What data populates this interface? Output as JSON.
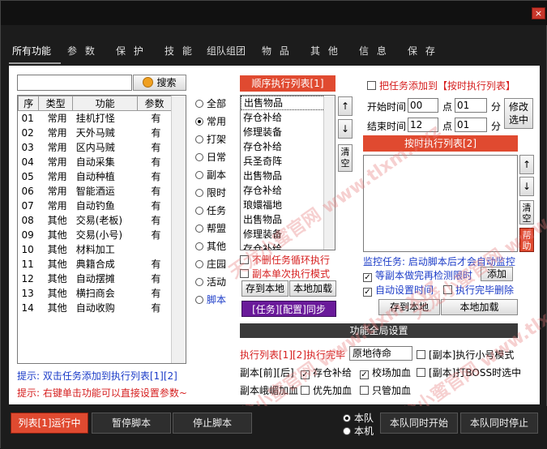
{
  "tabs": [
    "所有功能",
    "参 数",
    "保 护",
    "技 能",
    "组队组团",
    "物 品",
    "其 他",
    "信 息",
    "保 存"
  ],
  "search": {
    "value": "",
    "button": "搜索"
  },
  "table": {
    "headers": [
      "序",
      "类型",
      "功能",
      "参数"
    ],
    "rows": [
      [
        "01",
        "常用",
        "挂机打怪",
        "有"
      ],
      [
        "02",
        "常用",
        "天外马贼",
        "有"
      ],
      [
        "03",
        "常用",
        "区内马贼",
        "有"
      ],
      [
        "04",
        "常用",
        "自动采集",
        "有"
      ],
      [
        "05",
        "常用",
        "自动种植",
        "有"
      ],
      [
        "06",
        "常用",
        "智能酒运",
        "有"
      ],
      [
        "07",
        "常用",
        "自动钓鱼",
        "有"
      ],
      [
        "08",
        "其他",
        "交易(老板)",
        "有"
      ],
      [
        "09",
        "其他",
        "交易(小号)",
        "有"
      ],
      [
        "10",
        "其他",
        "材料加工",
        ""
      ],
      [
        "11",
        "其他",
        "典籍合成",
        "有"
      ],
      [
        "12",
        "其他",
        "自动摆摊",
        "有"
      ],
      [
        "13",
        "其他",
        "横扫商会",
        "有"
      ],
      [
        "14",
        "其他",
        "自动收购",
        "有"
      ]
    ]
  },
  "categories": [
    "全部",
    "常用",
    "打架",
    "日常",
    "副本",
    "限时",
    "任务",
    "帮盟",
    "其他",
    "庄园",
    "活动",
    "脚本"
  ],
  "category_selected": "常用",
  "hints": {
    "hint1": "提示: 双击任务添加到执行列表[1][2]",
    "hint2": "提示: 右键单击功能可以直接设置参数~"
  },
  "seq_list": {
    "title": "顺序执行列表[1]",
    "items": [
      "出售物品",
      "存仓补给",
      "修理装备",
      "存仓补给",
      "兵圣奇阵",
      "出售物品",
      "存仓补给",
      "琅嬛福地",
      "出售物品",
      "修理装备",
      "存仓补给"
    ],
    "up": "↑",
    "down": "↓",
    "clear": "清空"
  },
  "seq_options": {
    "no_delete_loop": "不删任务循环执行",
    "single_dungeon": "副本单次执行模式",
    "save_local": "存到本地",
    "load_local": "本地加载",
    "sync": "[任务][配置]同步"
  },
  "timed": {
    "add_label": "把任务添加到【按时执行列表】",
    "start_label": "开始时间",
    "end_label": "结束时间",
    "start_h": "00",
    "start_m": "01",
    "end_h": "12",
    "end_m": "01",
    "point": "点",
    "minute": "分",
    "modify": "修改选中",
    "list_title": "按时执行列表[2]",
    "up": "↑",
    "down": "↓",
    "clear": "清空",
    "help": "帮助",
    "monitor": "监控任务: 启动脚本后才会自动监控",
    "wait_dungeon": "等副本做完再检测限时",
    "add": "添加",
    "auto_time": "自动设置时间",
    "done_delete": "执行完毕删除",
    "save_local": "存到本地",
    "load_local": "本地加载"
  },
  "global": {
    "title": "功能全局设置",
    "after_exec_label": "执行列表[1][2]执行完毕",
    "after_exec_value": "原地待命",
    "small_mode": "[副本]执行小号模式",
    "dungeon_before_after": "副本[前][后]",
    "store_supply": "存仓补给",
    "arena_buff": "校场加血",
    "boss_fight": "[副本]打BOSS时选中",
    "dungeon_eyebrow": "副本峨嵋加血",
    "priority_buff": "优先加血",
    "only_buff": "只管加血"
  },
  "bottom": {
    "running": "列表[1]运行中",
    "pause": "暂停脚本",
    "stop": "停止脚本",
    "team": "本队",
    "machine": "本机",
    "team_start": "本队同时开始",
    "team_stop": "本队同时停止"
  },
  "watermark": "天龙小蜜官网 www.tlxm.xyz",
  "close": "×"
}
